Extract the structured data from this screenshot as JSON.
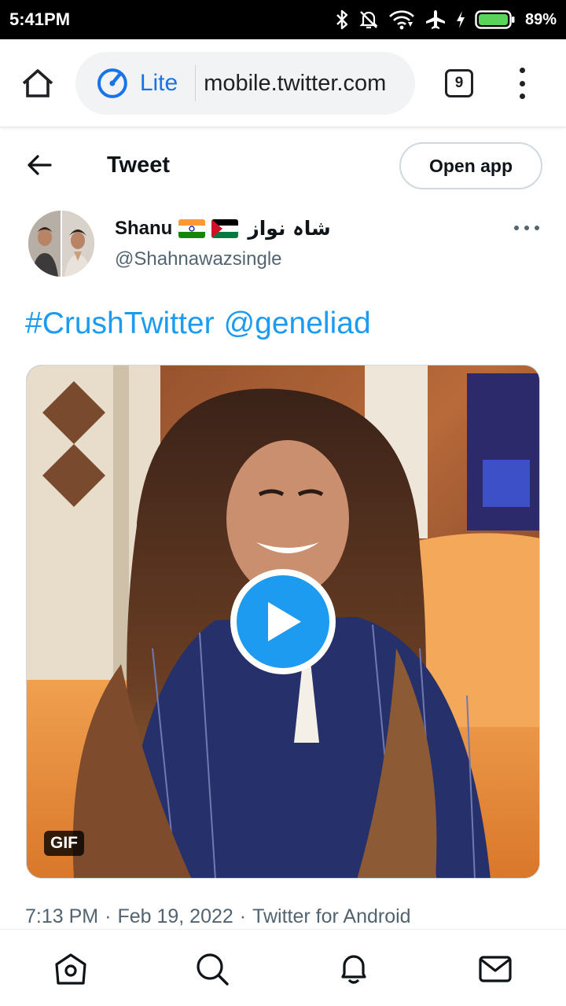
{
  "status_bar": {
    "time": "5:41PM",
    "battery_percent": "89%",
    "icons": [
      "bluetooth-icon",
      "bell-muted-icon",
      "wifi-icon",
      "airplane-mode-icon",
      "charging-icon",
      "battery-icon"
    ]
  },
  "browser": {
    "mode_label": "Lite",
    "url": "mobile.twitter.com",
    "tab_count": "9"
  },
  "header": {
    "title": "Tweet",
    "open_app_label": "Open app"
  },
  "tweet": {
    "author_name": "Shanu",
    "author_name_urdu": "شاہ نواز",
    "author_handle": "@Shahnawazsingle",
    "hashtag": "#CrushTwitter",
    "mention": "@geneliad",
    "media_badge": "GIF",
    "time": "7:13 PM",
    "date": "Feb 19, 2022",
    "source": "Twitter for Android",
    "separator": "·"
  },
  "bottom_nav": [
    {
      "name": "home",
      "icon": "home-icon"
    },
    {
      "name": "search",
      "icon": "search-icon"
    },
    {
      "name": "notifications",
      "icon": "bell-icon"
    },
    {
      "name": "messages",
      "icon": "mail-icon"
    }
  ],
  "colors": {
    "twitter_blue": "#1d9bf0",
    "chrome_blue": "#1a73e8",
    "text_primary": "#0f1419",
    "text_secondary": "#536471"
  }
}
